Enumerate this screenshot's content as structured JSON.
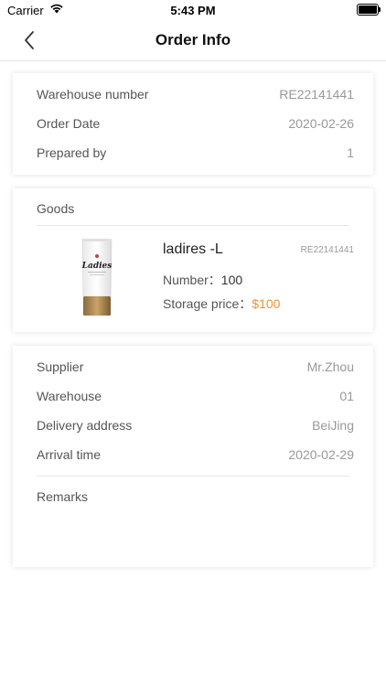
{
  "status_bar": {
    "carrier": "Carrier",
    "time": "5:43 PM"
  },
  "nav": {
    "title": "Order Info"
  },
  "order": {
    "rows": [
      {
        "label": "Warehouse number",
        "value": "RE22141441"
      },
      {
        "label": "Order Date",
        "value": "2020-02-26"
      },
      {
        "label": "Prepared by",
        "value": "1"
      }
    ]
  },
  "goods": {
    "title": "Goods",
    "product": {
      "name": "ladires -L",
      "code": "RE22141441",
      "number_label": "Number：",
      "number_value": "100",
      "price_label": "Storage price：",
      "price_value": "$100",
      "image_brand": "Ladies"
    }
  },
  "details": {
    "rows": [
      {
        "label": "Supplier",
        "value": "Mr.Zhou"
      },
      {
        "label": "Warehouse",
        "value": "01"
      },
      {
        "label": "Delivery address",
        "value": "BeiJing"
      },
      {
        "label": "Arrival time",
        "value": "2020-02-29"
      }
    ],
    "remarks_label": "Remarks"
  },
  "colors": {
    "price_accent": "#f0932b"
  }
}
